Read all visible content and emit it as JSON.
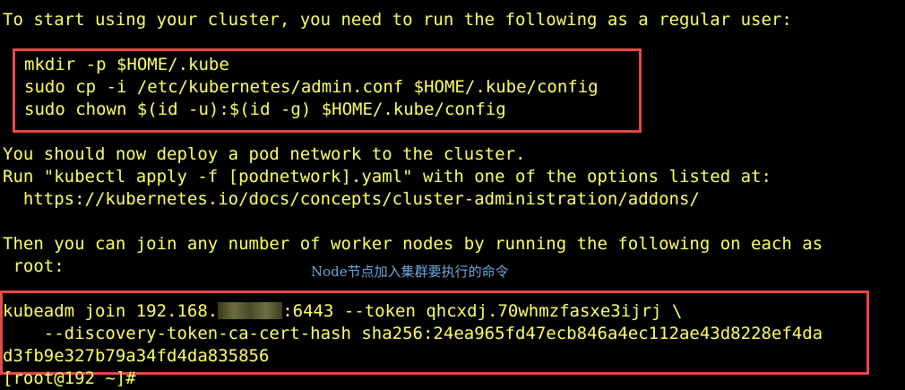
{
  "terminal": {
    "intro_line": "To start using your cluster, you need to run the following as a regular user:",
    "user_commands": [
      "mkdir -p $HOME/.kube",
      "sudo cp -i /etc/kubernetes/admin.conf $HOME/.kube/config",
      "sudo chown $(id -u):$(id -g) $HOME/.kube/config"
    ],
    "network_notice": [
      "You should now deploy a pod network to the cluster.",
      "Run \"kubectl apply -f [podnetwork].yaml\" with one of the options listed at:",
      "  https://kubernetes.io/docs/concepts/cluster-administration/addons/"
    ],
    "join_notice": [
      "Then you can join any number of worker nodes by running the following on each as",
      " root:"
    ],
    "annotation": "Node节点加入集群要执行的命令",
    "join_command": {
      "prefix": "kubeadm join 192.168.",
      "suffix": ":6443 --token qhcxdj.70whmzfasxe3ijrj \\",
      "line2": "    --discovery-token-ca-cert-hash sha256:24ea965fd47ecb846a4ec112ae43d8228ef4da",
      "line3": "d3fb9e327b79a34fd4da835856"
    },
    "prompt": "[root@192 ~]# "
  },
  "colors": {
    "background": "#000000",
    "text": "#ffff66",
    "highlight_box": "#e84848",
    "annotation": "#6fa8dc"
  }
}
